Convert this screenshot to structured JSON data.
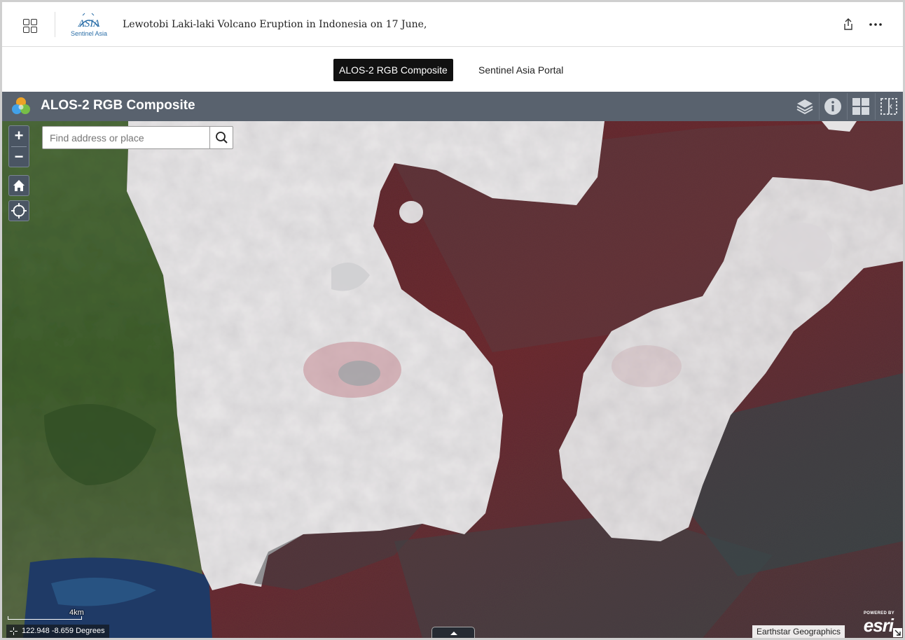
{
  "header": {
    "app_title": "Lewotobi Laki-laki Volcano Eruption in Indonesia on 17 June,",
    "logo_caption": "Sentinel Asia",
    "logo_wordmark": "ASIA",
    "icons": [
      "apps-grid-icon",
      "share-icon",
      "more-icon"
    ]
  },
  "tabs": [
    {
      "label": "ALOS-2 RGB Composite",
      "active": true
    },
    {
      "label": "Sentinel Asia Portal",
      "active": false
    }
  ],
  "map_header": {
    "title": "ALOS-2 RGB Composite",
    "tools": [
      "layers-icon",
      "info-icon",
      "grid-icon",
      "swipe-icon"
    ],
    "bg_color": "#59626e"
  },
  "map": {
    "zoom_in": "+",
    "zoom_out": "−",
    "search_placeholder": "Find address or place",
    "scale_label": "4km",
    "coordinates": "122.948 -8.659 Degrees",
    "attribution": "Earthstar Geographics",
    "powered_by": "POWERED BY",
    "esri": "esri"
  }
}
